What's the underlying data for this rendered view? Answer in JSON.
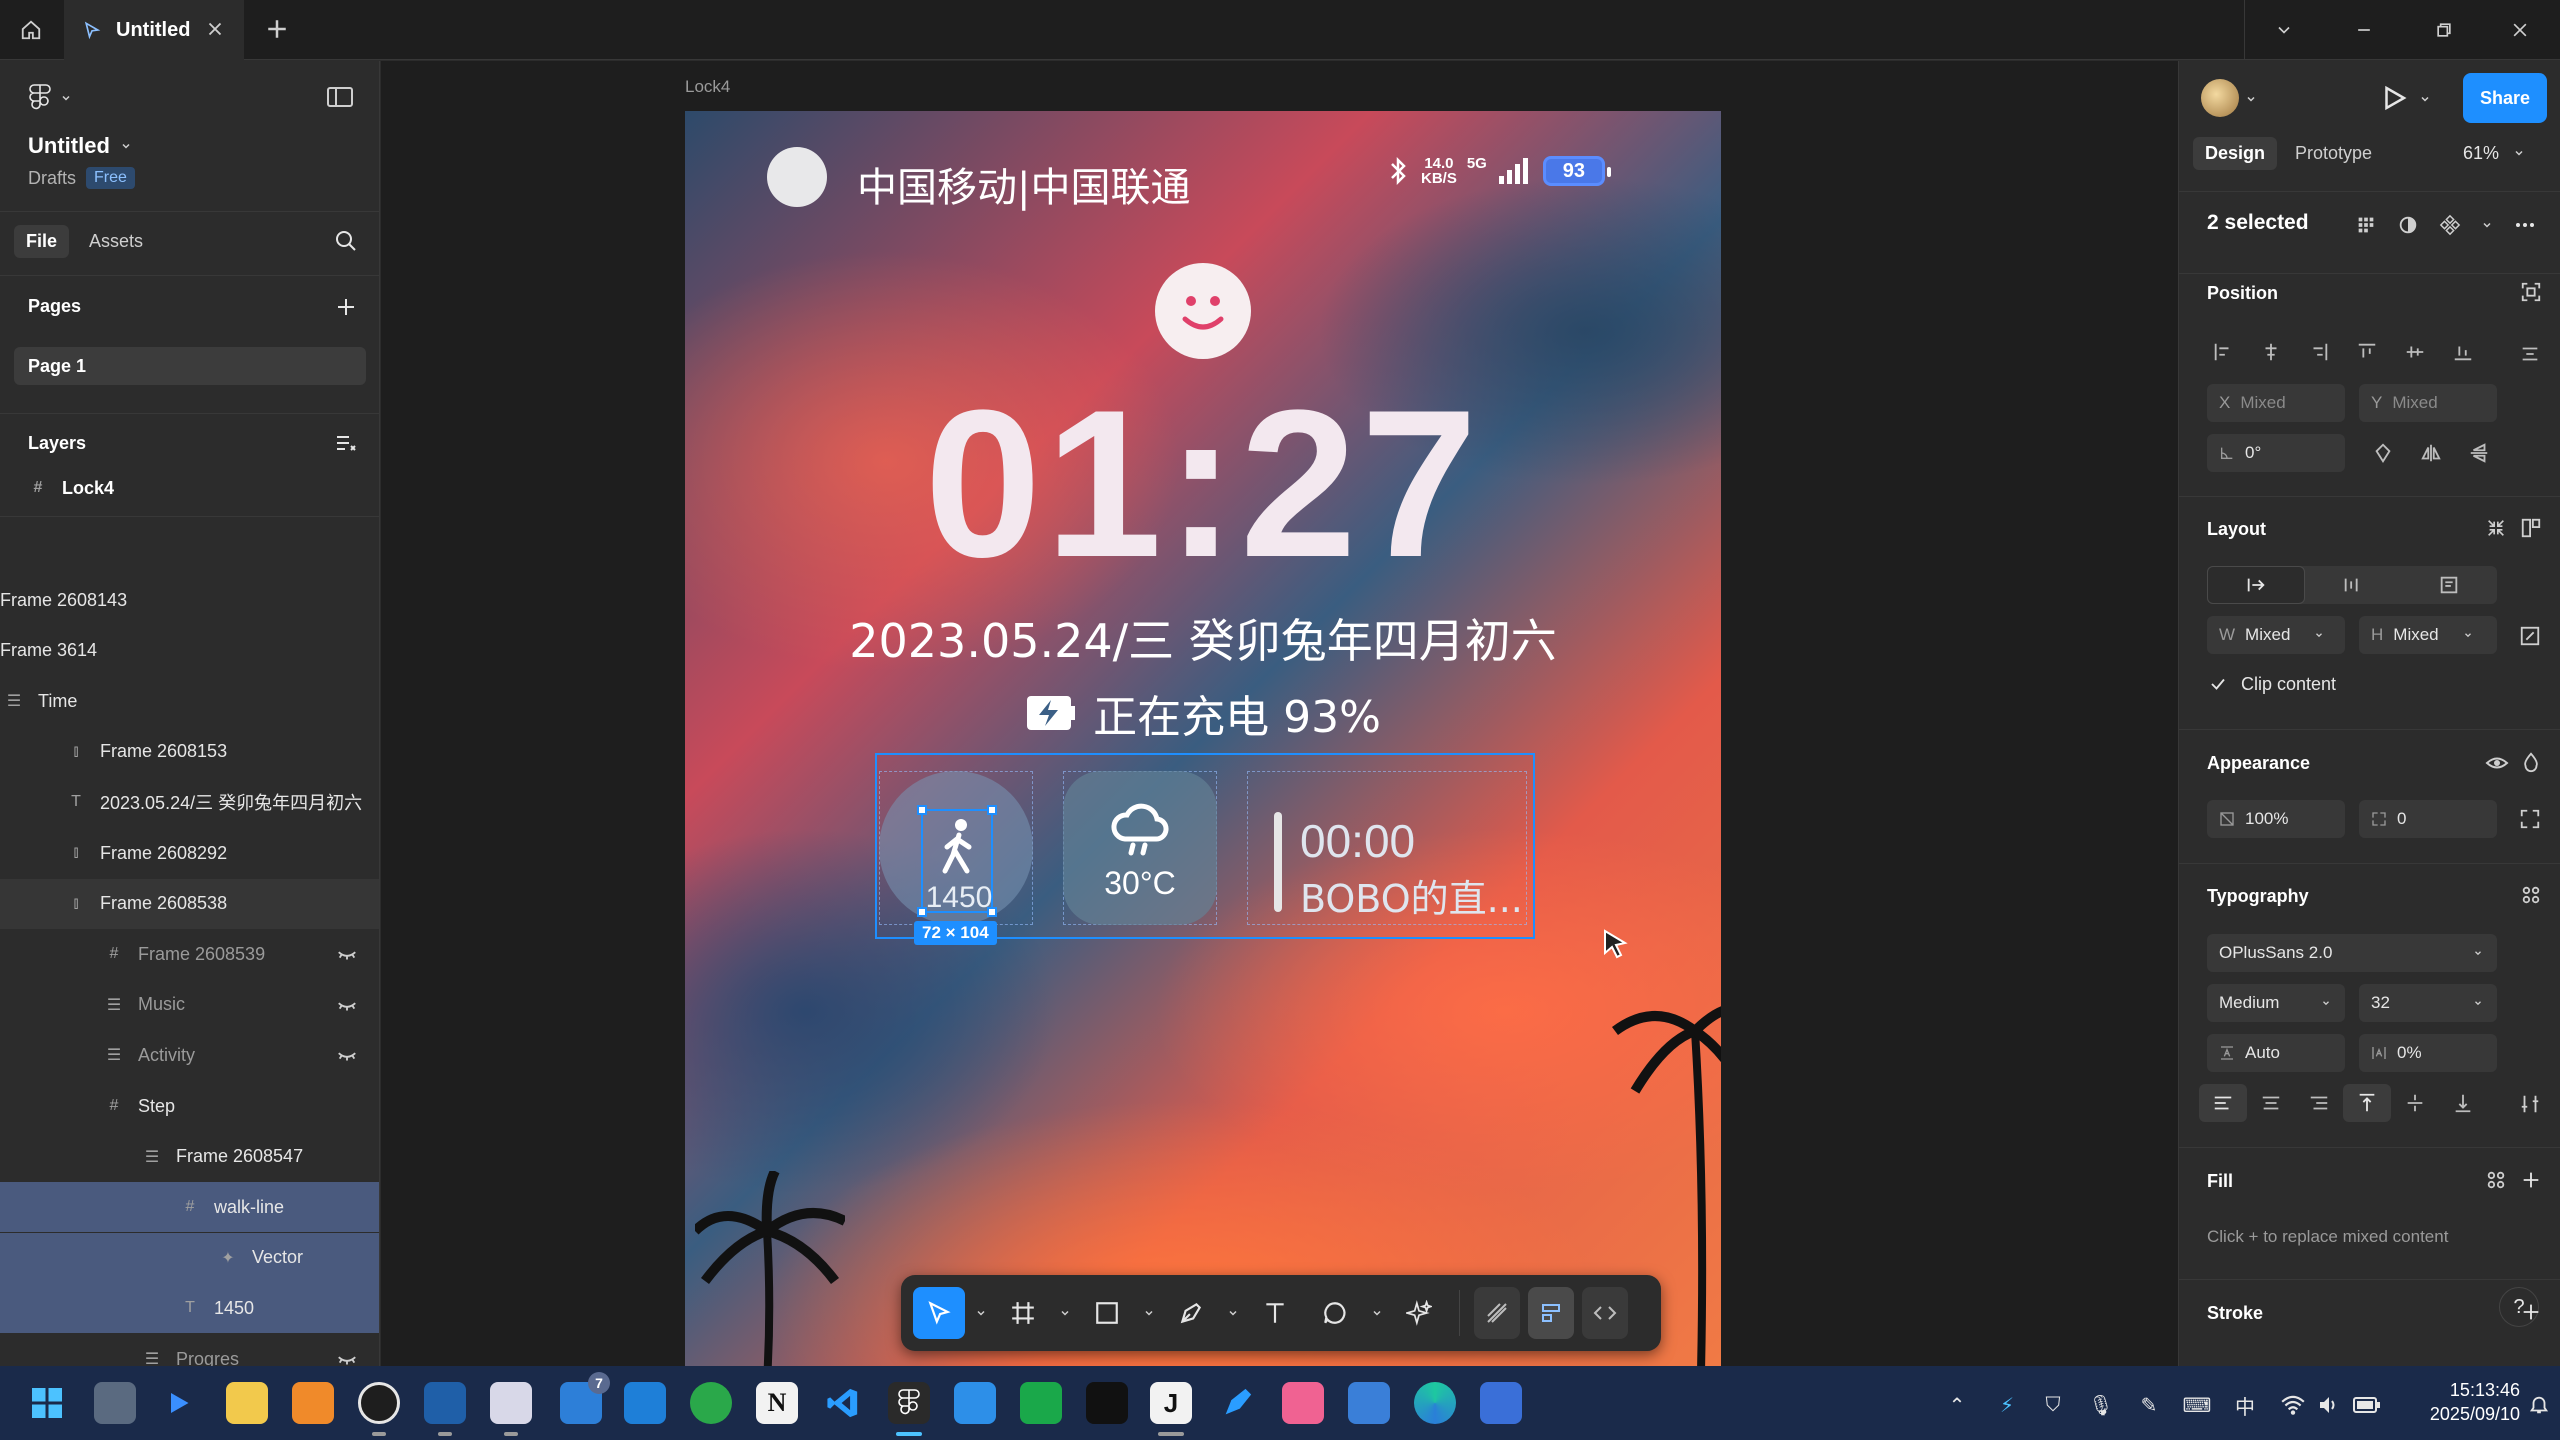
{
  "window": {
    "tab_title": "Untitled"
  },
  "left_panel": {
    "file_name": "Untitled",
    "drafts_label": "Drafts",
    "plan_badge": "Free",
    "tabs": {
      "file": "File",
      "assets": "Assets"
    },
    "pages_title": "Pages",
    "page_item": "Page 1",
    "layers_title": "Layers",
    "top_layer": "Lock4",
    "layers": [
      {
        "label": "Frame 2608143",
        "icon": "none",
        "indent": 0,
        "state": "normal",
        "hidden": false
      },
      {
        "label": "Frame 3614",
        "icon": "none",
        "indent": 0,
        "state": "normal",
        "hidden": false
      },
      {
        "label": "Time",
        "icon": "autolayout-icon",
        "indent": 0,
        "state": "normal",
        "hidden": false
      },
      {
        "label": "Frame 2608153",
        "icon": "column-icon",
        "indent": 1,
        "state": "normal",
        "hidden": false
      },
      {
        "label": "2023.05.24/三 癸卯兔年四月初六",
        "icon": "text-icon",
        "indent": 1,
        "state": "normal",
        "hidden": false
      },
      {
        "label": "Frame 2608292",
        "icon": "column-icon",
        "indent": 1,
        "state": "normal",
        "hidden": false
      },
      {
        "label": "Frame 2608538",
        "icon": "column-icon",
        "indent": 1,
        "state": "hover",
        "hidden": false
      },
      {
        "label": "Frame 2608539",
        "icon": "frame-icon",
        "indent": 2,
        "state": "dim",
        "hidden": true
      },
      {
        "label": "Music",
        "icon": "autolayout-icon",
        "indent": 2,
        "state": "dim",
        "hidden": true
      },
      {
        "label": "Activity",
        "icon": "autolayout-icon",
        "indent": 2,
        "state": "dim",
        "hidden": true
      },
      {
        "label": "Step",
        "icon": "frame-icon",
        "indent": 2,
        "state": "normal",
        "hidden": false
      },
      {
        "label": "Frame 2608547",
        "icon": "autolayout-icon",
        "indent": 3,
        "state": "normal",
        "hidden": false
      },
      {
        "label": "walk-line",
        "icon": "frame-icon",
        "indent": 4,
        "state": "selected",
        "hidden": false
      },
      {
        "label": "Vector",
        "icon": "vector-icon",
        "indent": 5,
        "state": "selected",
        "hidden": false
      },
      {
        "label": "1450",
        "icon": "text-icon",
        "indent": 4,
        "state": "selected",
        "hidden": false
      },
      {
        "label": "Progres",
        "icon": "autolayout-icon",
        "indent": 3,
        "state": "dim",
        "hidden": true
      }
    ]
  },
  "canvas": {
    "frame_label": "Lock4",
    "phone": {
      "carrier": "中国移动|中国联通",
      "speed_top": "14.0",
      "speed_bottom": "KB/S",
      "network": "5G",
      "battery": "93",
      "time": "01:27",
      "date": "2023.05.24/三  癸卯兔年四月初六",
      "charging": "正在充电 93%",
      "steps": "1450",
      "selection_size": "72 × 104",
      "temperature": "30°C",
      "music_time": "00:00",
      "music_title": "BOBO的直..."
    }
  },
  "right_panel": {
    "tabs": {
      "design": "Design",
      "prototype": "Prototype"
    },
    "zoom": "61%",
    "share": "Share",
    "selected": "2 selected",
    "position": {
      "title": "Position",
      "x_key": "X",
      "x_val": "Mixed",
      "y_key": "Y",
      "y_val": "Mixed",
      "rotation": "0°"
    },
    "layout": {
      "title": "Layout",
      "w_key": "W",
      "w_val": "Mixed",
      "h_key": "H",
      "h_val": "Mixed",
      "clip": "Clip content"
    },
    "appearance": {
      "title": "Appearance",
      "opacity": "100%",
      "radius": "0"
    },
    "typography": {
      "title": "Typography",
      "font": "OPlusSans 2.0",
      "weight": "Medium",
      "size": "32",
      "line_height": "Auto",
      "letter_spacing": "0%"
    },
    "fill": {
      "title": "Fill",
      "hint": "Click + to replace mixed content"
    },
    "stroke": {
      "title": "Stroke"
    },
    "help": "?"
  },
  "taskbar": {
    "time": "15:13:46",
    "date": "2025/09/10",
    "ime": "中",
    "badge": "7"
  }
}
